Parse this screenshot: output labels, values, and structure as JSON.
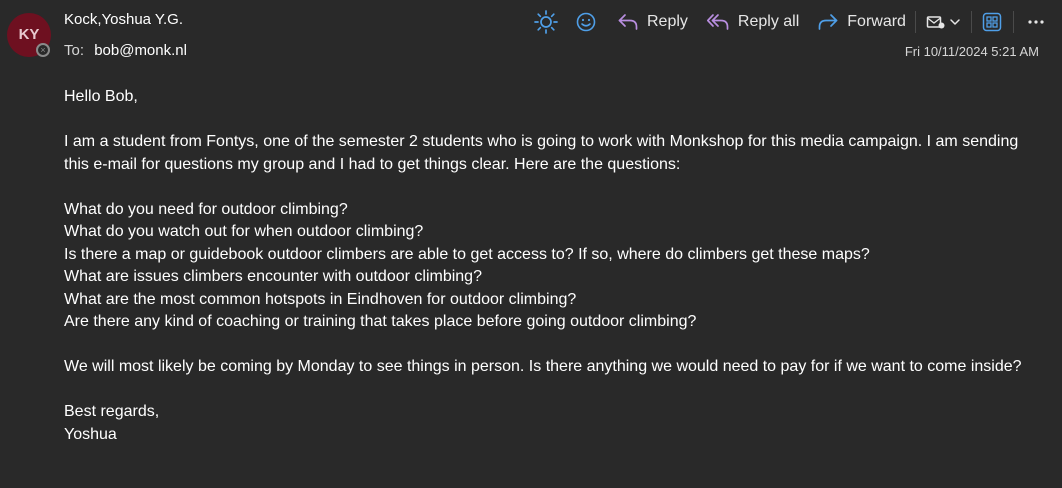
{
  "sender": {
    "initials": "KY",
    "name": "Kock,Yoshua Y.G.",
    "to_label": "To:",
    "to_address": "bob@monk.nl"
  },
  "toolbar": {
    "reply_label": "Reply",
    "reply_all_label": "Reply all",
    "forward_label": "Forward"
  },
  "date": "Fri 10/11/2024 5:21 AM",
  "body": {
    "greeting": "Hello Bob,",
    "intro": "I am a student from Fontys, one of the semester 2 students who is going to work with Monkshop for this media campaign. I am sending this e-mail for questions my group and I had to get things clear. Here are the questions:",
    "questions": [
      "What do you need for outdoor climbing?",
      "What do you watch out for when outdoor climbing?",
      "Is there a map or guidebook outdoor climbers are able to get access to? If so, where do climbers get these maps?",
      "What are issues climbers encounter with outdoor climbing?",
      "What are the most common hotspots in Eindhoven for outdoor climbing?",
      "Are there any kind of coaching or training that takes place before going outdoor climbing?"
    ],
    "closing_paragraph": "We will most likely be coming by Monday to see things in person. Is there anything we would need to pay for if we want to come inside?",
    "sign_off": "Best regards,",
    "signature": "Yoshua"
  },
  "colors": {
    "background": "#292929",
    "accent": "#4f9fe8",
    "reply_all_accent": "#b98ee0",
    "avatar": "#6e1020"
  },
  "icons": [
    "sun-icon",
    "smiley-icon",
    "reply-icon",
    "reply-all-icon",
    "forward-icon",
    "tag-icon",
    "chevron-down-icon",
    "apps-icon",
    "more-icon",
    "offline-status-icon"
  ]
}
